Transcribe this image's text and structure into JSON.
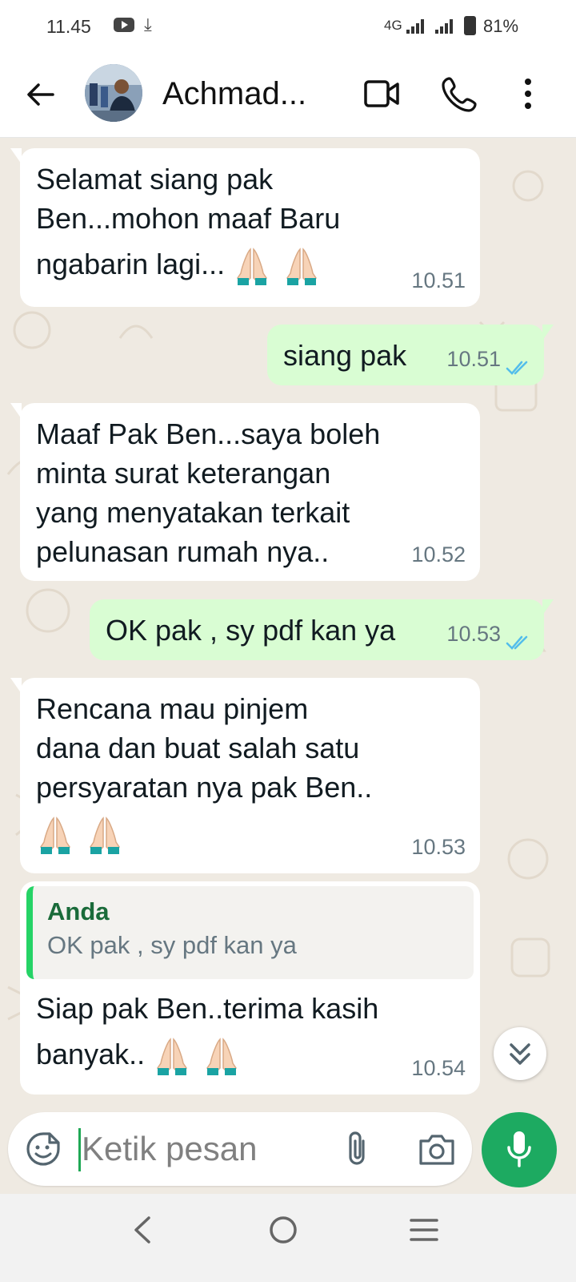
{
  "status_bar": {
    "time": "11.45",
    "network": "4G",
    "battery": "81%",
    "icons": [
      "youtube-icon",
      "download-icon",
      "signal-icon",
      "battery-icon"
    ]
  },
  "header": {
    "contact_name": "Achmad...",
    "icons": [
      "back-arrow-icon",
      "video-call-icon",
      "voice-call-icon",
      "more-options-icon"
    ]
  },
  "messages": [
    {
      "direction": "incoming",
      "lines": [
        "Selamat siang pak",
        "Ben...mohon maaf Baru"
      ],
      "last_line": "ngabarin lagi...",
      "emoji_count": 2,
      "time": "10.51"
    },
    {
      "direction": "outgoing",
      "text": "siang pak",
      "time": "10.51",
      "status": "read"
    },
    {
      "direction": "incoming",
      "lines": [
        "Maaf Pak Ben...saya boleh",
        "minta surat keterangan",
        "yang menyatakan terkait",
        "pelunasan rumah nya.."
      ],
      "time": "10.52"
    },
    {
      "direction": "outgoing",
      "text": "OK pak , sy pdf kan ya",
      "time": "10.53",
      "status": "read"
    },
    {
      "direction": "incoming",
      "lines": [
        "Rencana mau pinjem",
        "dana dan buat salah satu",
        "persyaratan nya pak Ben.."
      ],
      "emoji_count": 2,
      "time": "10.53"
    },
    {
      "direction": "incoming",
      "quote": {
        "author": "Anda",
        "text": "OK pak , sy pdf kan ya"
      },
      "lines": [
        "Siap pak Ben..terima kasih"
      ],
      "last_line": "banyak..",
      "emoji_count": 2,
      "time": "10.54"
    }
  ],
  "input": {
    "placeholder": "Ketik pesan"
  },
  "colors": {
    "incoming_bubble": "#ffffff",
    "outgoing_bubble": "#d9fdd3",
    "accent_green": "#1daa61",
    "read_ticks": "#53bdeb",
    "quote_author": "#1a6b3a"
  },
  "nav_bar": {
    "icons": [
      "nav-back-icon",
      "nav-home-icon",
      "nav-recents-icon"
    ]
  }
}
